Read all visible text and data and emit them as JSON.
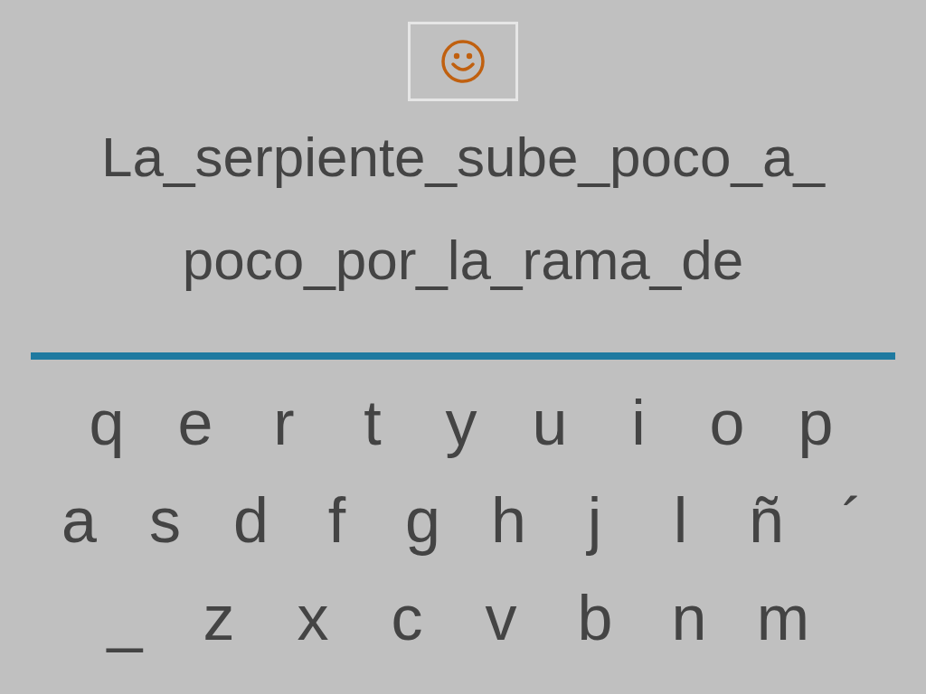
{
  "sentence_lines": [
    "La_serpiente_sube_poco_a_",
    "poco_por_la_rama_de"
  ],
  "keyboard": {
    "rows": [
      {
        "keys": [
          "q",
          "e",
          "r",
          "t",
          "y",
          "u",
          "i",
          "o",
          "p"
        ]
      },
      {
        "keys": [
          "a",
          "s",
          "d",
          "f",
          "g",
          "h",
          "j",
          "l",
          "ñ",
          "´"
        ]
      },
      {
        "keys": [
          "_",
          "z",
          "x",
          "c",
          "v",
          "b",
          "n",
          "m"
        ]
      }
    ]
  }
}
